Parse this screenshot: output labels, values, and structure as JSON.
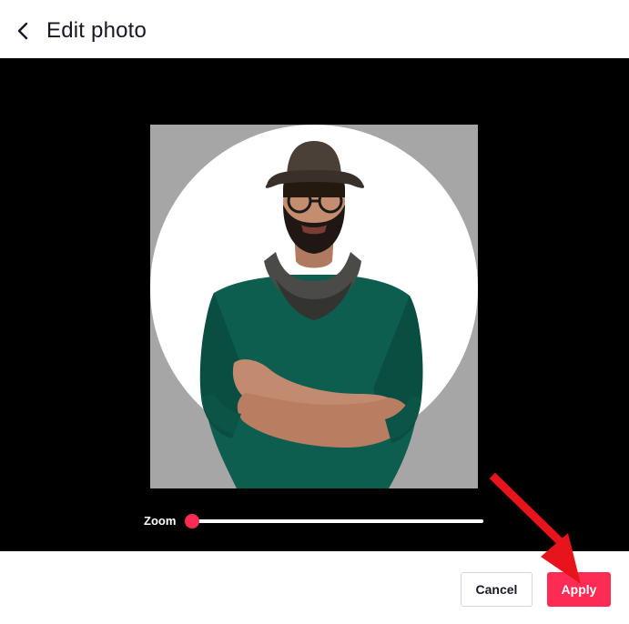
{
  "header": {
    "back_icon": "chevron-left-icon",
    "title": "Edit photo"
  },
  "editor": {
    "crop_shape": "circle",
    "zoom": {
      "label": "Zoom",
      "value": 0
    }
  },
  "footer": {
    "cancel_label": "Cancel",
    "apply_label": "Apply"
  },
  "annotation": {
    "pointer_icon": "red-arrow-icon",
    "color": "#e8141c"
  },
  "colors": {
    "accent": "#fe2c55",
    "stage": "#000000",
    "crop_surround": "#a6a6a6"
  }
}
